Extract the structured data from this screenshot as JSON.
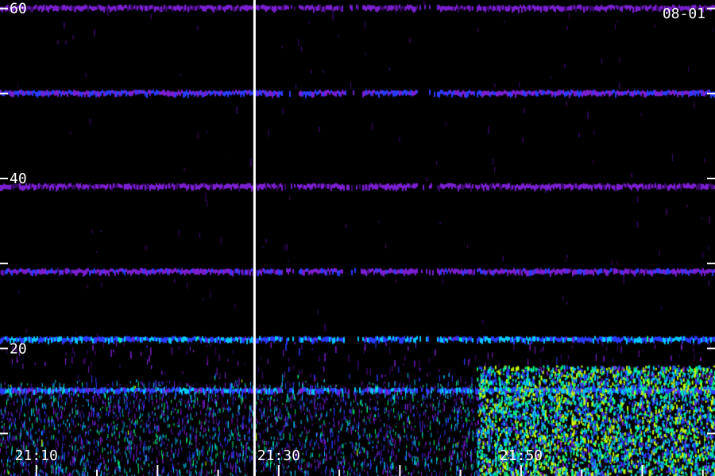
{
  "chart_data": {
    "type": "heatmap",
    "title": "",
    "date_label": "08-01",
    "xlabel": "",
    "ylabel": "",
    "x_tick_labels": [
      "21:10",
      "21:30",
      "21:50"
    ],
    "x_range_minutes": [
      "21:07",
      "21:66"
    ],
    "y_ticks": [
      10,
      20,
      30,
      40,
      50,
      60
    ],
    "y_tick_labels": [
      "",
      "20",
      "",
      "40",
      "",
      "60"
    ],
    "ylim": [
      5,
      61
    ],
    "colormap": [
      "#000000",
      "#3a0a6a",
      "#7a1fd0",
      "#2a3cff",
      "#00c8ff",
      "#00ff80",
      "#c8ff00",
      "#ffffff"
    ],
    "marker_time": "21:28",
    "grid": false,
    "horizontal_bands": [
      {
        "y": 60,
        "intensity": 0.35
      },
      {
        "y": 50,
        "intensity": 0.45
      },
      {
        "y": 39,
        "intensity": 0.35
      },
      {
        "y": 29,
        "intensity": 0.4
      },
      {
        "y": 21,
        "intensity": 0.6
      },
      {
        "y": 15,
        "intensity": 0.55
      }
    ]
  }
}
